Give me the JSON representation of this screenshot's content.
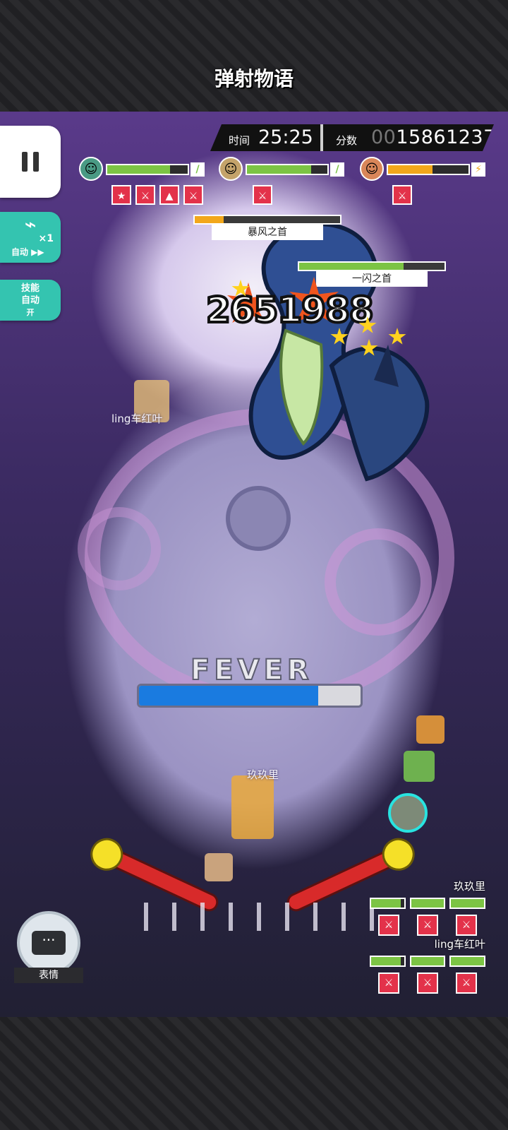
{
  "logo": {
    "text": "弹射物语"
  },
  "hud": {
    "time_label": "时间",
    "time_value": "25:25",
    "score_label": "分数",
    "score_prefix": "00",
    "score_value": "15861237"
  },
  "controls": {
    "auto_multiplier": "×1",
    "auto_label": "自动 ▶▶",
    "skill_auto_line1": "技能",
    "skill_auto_line2": "自动",
    "skill_auto_state": "开"
  },
  "party": [
    {
      "hp": 0.78,
      "color": "#7cc444",
      "badge": "/",
      "badge_color": "#7cc444",
      "skills": [
        "★",
        "⚔",
        "▲",
        "⚔"
      ]
    },
    {
      "hp": 0.8,
      "color": "#7cc444",
      "badge": "/",
      "badge_color": "#7cc444",
      "skills": [
        "⚔"
      ]
    },
    {
      "hp": 0.55,
      "color": "#f2a71b",
      "badge": "⚡",
      "badge_color": "#f2a71b",
      "skills": [
        "⚔"
      ]
    }
  ],
  "bosses": [
    {
      "name": "暴风之首",
      "hp": 0.2,
      "color": "#f2a71b"
    },
    {
      "name": "一闪之首",
      "hp": 0.72,
      "color": "#7cc444"
    }
  ],
  "damage": "2651988",
  "fever": {
    "label": "FEVER",
    "fill": 0.81
  },
  "field_names": {
    "ling": "ling车红叶",
    "jiu": "玖玖里"
  },
  "players": [
    {
      "name": "玖玖里",
      "hp": [
        0.9,
        1.0,
        1.0
      ]
    },
    {
      "name": "ling车红叶",
      "hp": [
        0.9,
        1.0,
        1.0
      ]
    }
  ],
  "emote": {
    "label": "表情",
    "icon": "···"
  }
}
